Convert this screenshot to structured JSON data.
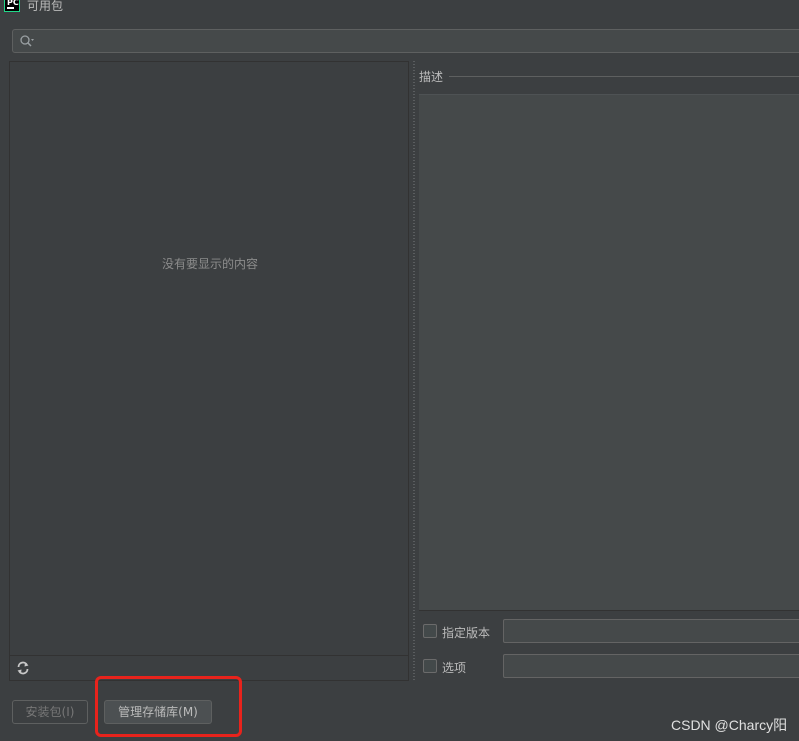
{
  "window": {
    "title": "可用包",
    "icon": "pycharm-icon"
  },
  "search": {
    "value": "",
    "placeholder": "",
    "icon": "search-icon"
  },
  "package_list": {
    "empty_text": "没有要显示的内容",
    "refresh_icon": "refresh-icon"
  },
  "description": {
    "label": "描述",
    "content": ""
  },
  "options": {
    "version_label": "指定版本",
    "version_checked": false,
    "version_value": "",
    "options_label": "选项",
    "options_checked": false,
    "options_value": ""
  },
  "buttons": {
    "install_label": "安装包(I)",
    "install_enabled": false,
    "manage_repo_label": "管理存储库(M)"
  },
  "watermark": "CSDN @Charcy阳",
  "colors": {
    "background": "#3c3f41",
    "highlight": "#e8231c",
    "text": "#bbbbbb"
  }
}
